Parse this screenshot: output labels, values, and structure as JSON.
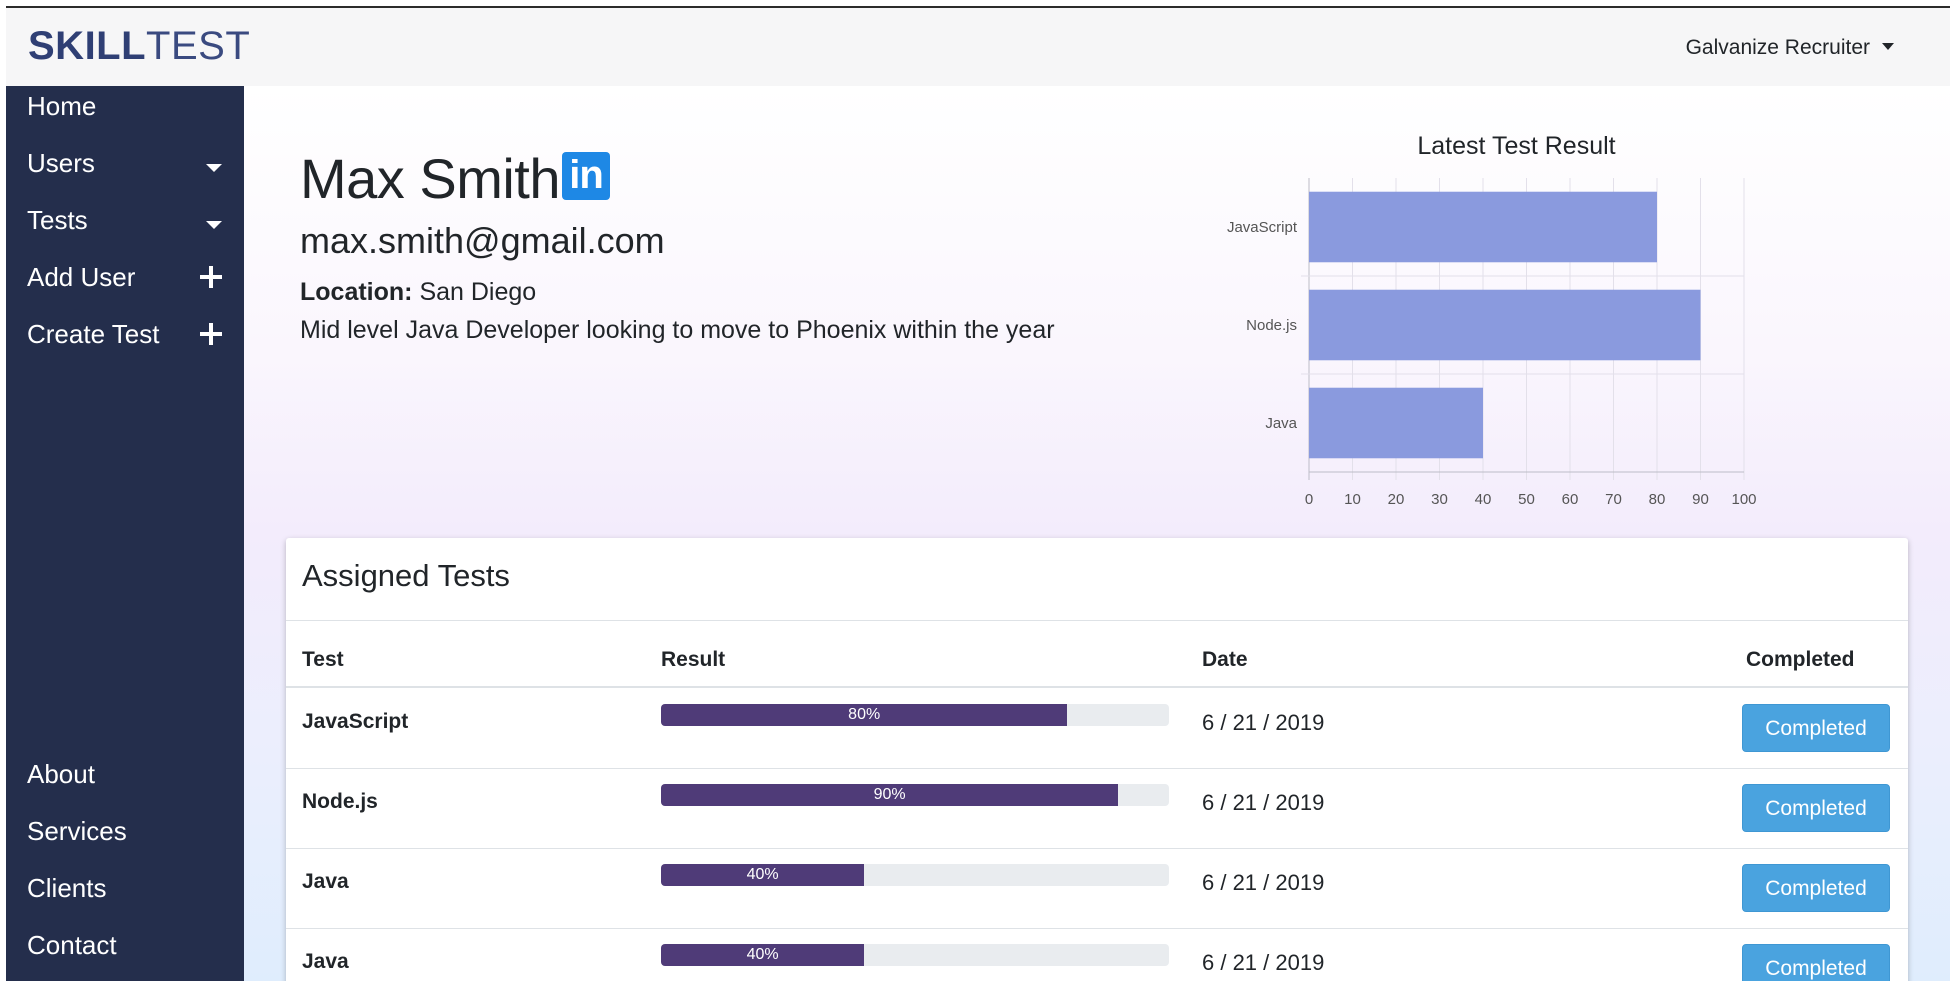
{
  "brand": {
    "part1": "SKILL",
    "part2": "TEST"
  },
  "user_menu": {
    "label": "Galvanize Recruiter"
  },
  "sidebar": {
    "top_items": [
      {
        "label": "Home"
      },
      {
        "label": "Users"
      },
      {
        "label": "Tests"
      },
      {
        "label": "Add User"
      },
      {
        "label": "Create Test"
      }
    ],
    "bottom_items": [
      {
        "label": "About"
      },
      {
        "label": "Services"
      },
      {
        "label": "Clients"
      },
      {
        "label": "Contact"
      }
    ]
  },
  "profile": {
    "name": "Max Smith",
    "linkedin_text": "in",
    "email": "max.smith@gmail.com",
    "location_label": "Location:",
    "location_value": " San Diego",
    "bio": "Mid level Java Developer looking to move to Phoenix within the year"
  },
  "chart_data": {
    "type": "bar",
    "orientation": "horizontal",
    "title": "Latest Test Result",
    "categories": [
      "JavaScript",
      "Node.js",
      "Java"
    ],
    "values": [
      80,
      90,
      40
    ],
    "xlim": [
      0,
      100
    ],
    "xticks": [
      0,
      10,
      20,
      30,
      40,
      50,
      60,
      70,
      80,
      90,
      100
    ],
    "grid": true,
    "bar_color": "#8898dd"
  },
  "assigned": {
    "title": "Assigned Tests",
    "headers": {
      "test": "Test",
      "result": "Result",
      "date": "Date",
      "completed": "Completed"
    },
    "rows": [
      {
        "test": "JavaScript",
        "percent": 80,
        "result_label": "80%",
        "date": "6 / 21 / 2019",
        "status": "Completed"
      },
      {
        "test": "Node.js",
        "percent": 90,
        "result_label": "90%",
        "date": "6 / 21 / 2019",
        "status": "Completed"
      },
      {
        "test": "Java",
        "percent": 40,
        "result_label": "40%",
        "date": "6 / 21 / 2019",
        "status": "Completed"
      },
      {
        "test": "Java",
        "percent": 40,
        "result_label": "40%",
        "date": "6 / 21 / 2019",
        "status": "Completed"
      }
    ]
  },
  "colors": {
    "sidebar_bg": "#242e4c",
    "progress_fill": "#4f3b78",
    "button_bg": "#4aa3df",
    "brand": "#2f3f74"
  }
}
